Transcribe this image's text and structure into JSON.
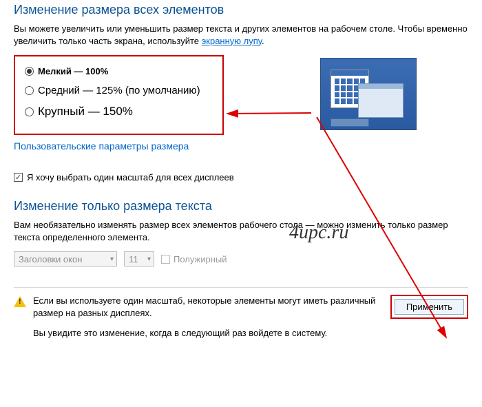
{
  "section1": {
    "heading": "Изменение размера всех элементов",
    "desc_a": "Вы можете увеличить или уменьшить размер текста и других элементов на рабочем столе. Чтобы временно увеличить только часть экрана, используйте ",
    "magnifier_link": "экранную лупу",
    "desc_b": "."
  },
  "scale_options": {
    "small": "Мелкий — 100%",
    "medium": "Средний — 125% (по умолчанию)",
    "large": "Крупный — 150%",
    "selected": "small"
  },
  "custom_link": "Пользовательские параметры размера",
  "checkbox_all_displays": "Я хочу выбрать один масштаб для всех дисплеев",
  "section2": {
    "heading": "Изменение только размера текста",
    "desc": "Вам необязательно изменять размер всех элементов рабочего стола — можно изменить только размер текста определенного элемента."
  },
  "text_only": {
    "element_combo": "Заголовки окон",
    "size_combo": "11",
    "bold_label": "Полужирный"
  },
  "footer": {
    "warn1": "Если вы используете один масштаб, некоторые элементы могут иметь различный размер на разных дисплеях.",
    "warn2": "Вы увидите это изменение, когда в следующий раз войдете в систему.",
    "apply": "Применить"
  },
  "watermark": "4upc.ru"
}
